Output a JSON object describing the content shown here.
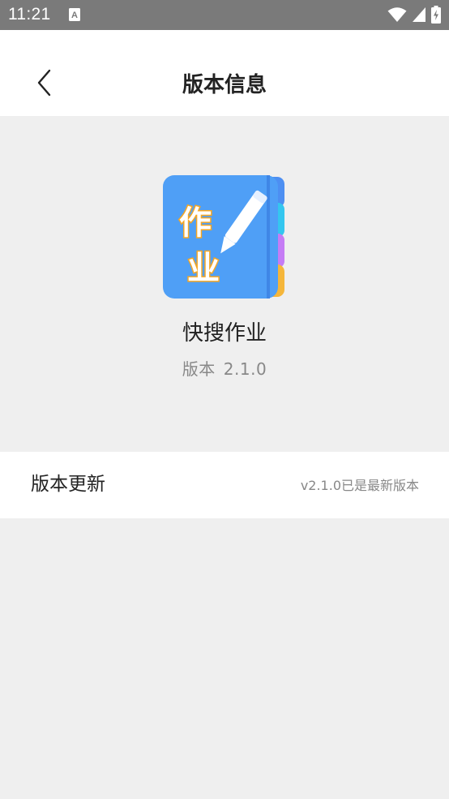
{
  "status_bar": {
    "time": "11:21",
    "notification_icon": "a-letter-icon",
    "icons": [
      "wifi-icon",
      "signal-icon",
      "battery-charging-icon"
    ]
  },
  "header": {
    "title": "版本信息",
    "back_icon": "chevron-left-icon"
  },
  "app": {
    "icon_text_top": "作",
    "icon_text_bottom": "业",
    "name": "快搜作业",
    "version_label": "版本",
    "version_number": "2.1.0"
  },
  "update": {
    "label": "版本更新",
    "status": "v2.1.0已是最新版本"
  },
  "colors": {
    "status_bar": "#7a7a7a",
    "background": "#efefef",
    "icon_blue": "#4f9ff6",
    "tab_cyan": "#34c6ef",
    "tab_purple": "#c57cf5",
    "tab_orange": "#f5b63a"
  }
}
